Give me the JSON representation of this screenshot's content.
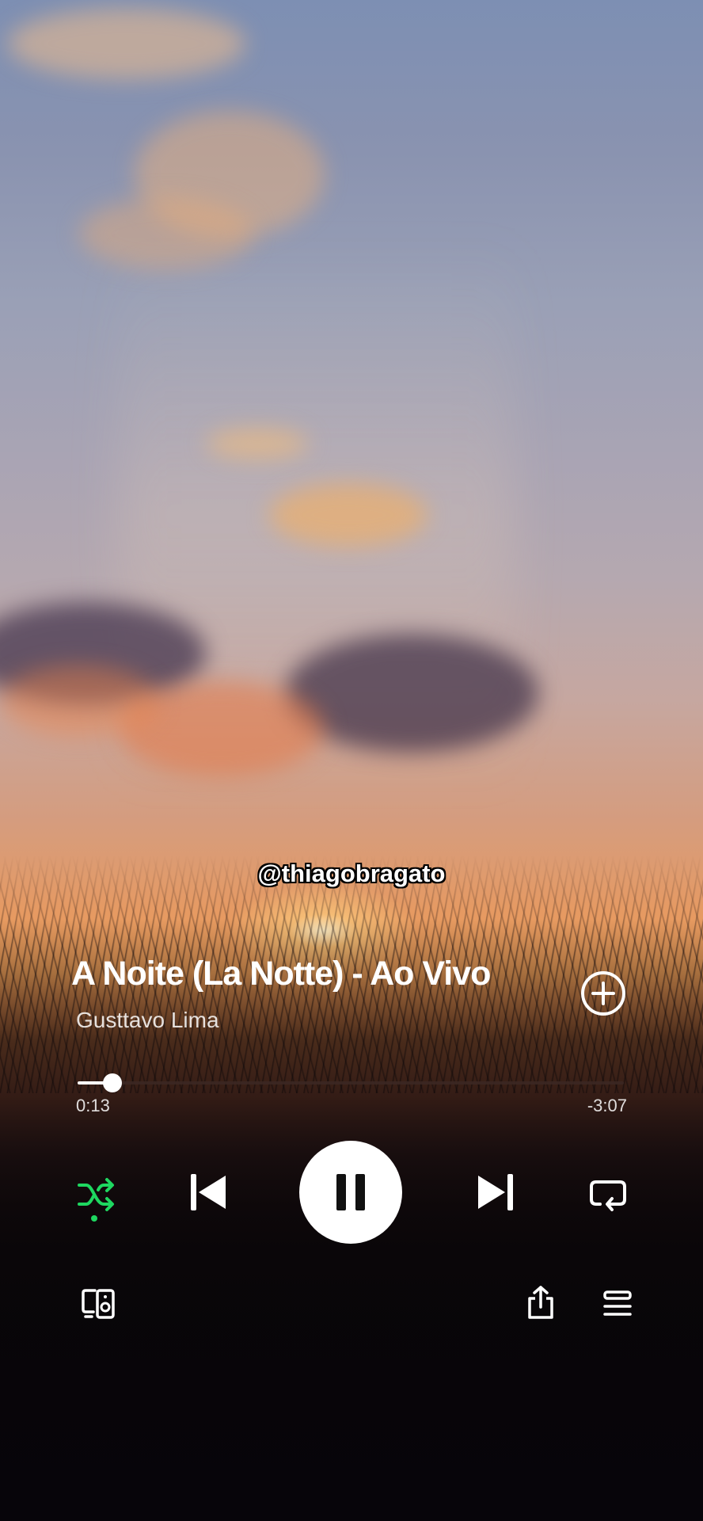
{
  "watermark": "@thiagobragato",
  "track": {
    "title": "A Noite (La Notte) - Ao Vivo",
    "artist": "Gusttavo Lima"
  },
  "playback": {
    "elapsed": "0:13",
    "remaining": "-3:07",
    "progress_fraction": 0.064,
    "is_playing": true,
    "shuffle_active": true
  },
  "icons": {
    "add": "plus-circle-icon",
    "shuffle": "shuffle-icon",
    "previous": "skip-previous-icon",
    "play_pause": "pause-icon",
    "next": "skip-next-icon",
    "repeat": "repeat-icon",
    "devices": "connect-devices-icon",
    "share": "share-icon",
    "queue": "queue-icon"
  },
  "colors": {
    "accent": "#1ed760",
    "text": "#ffffff",
    "track_bg": "#3c2823"
  }
}
